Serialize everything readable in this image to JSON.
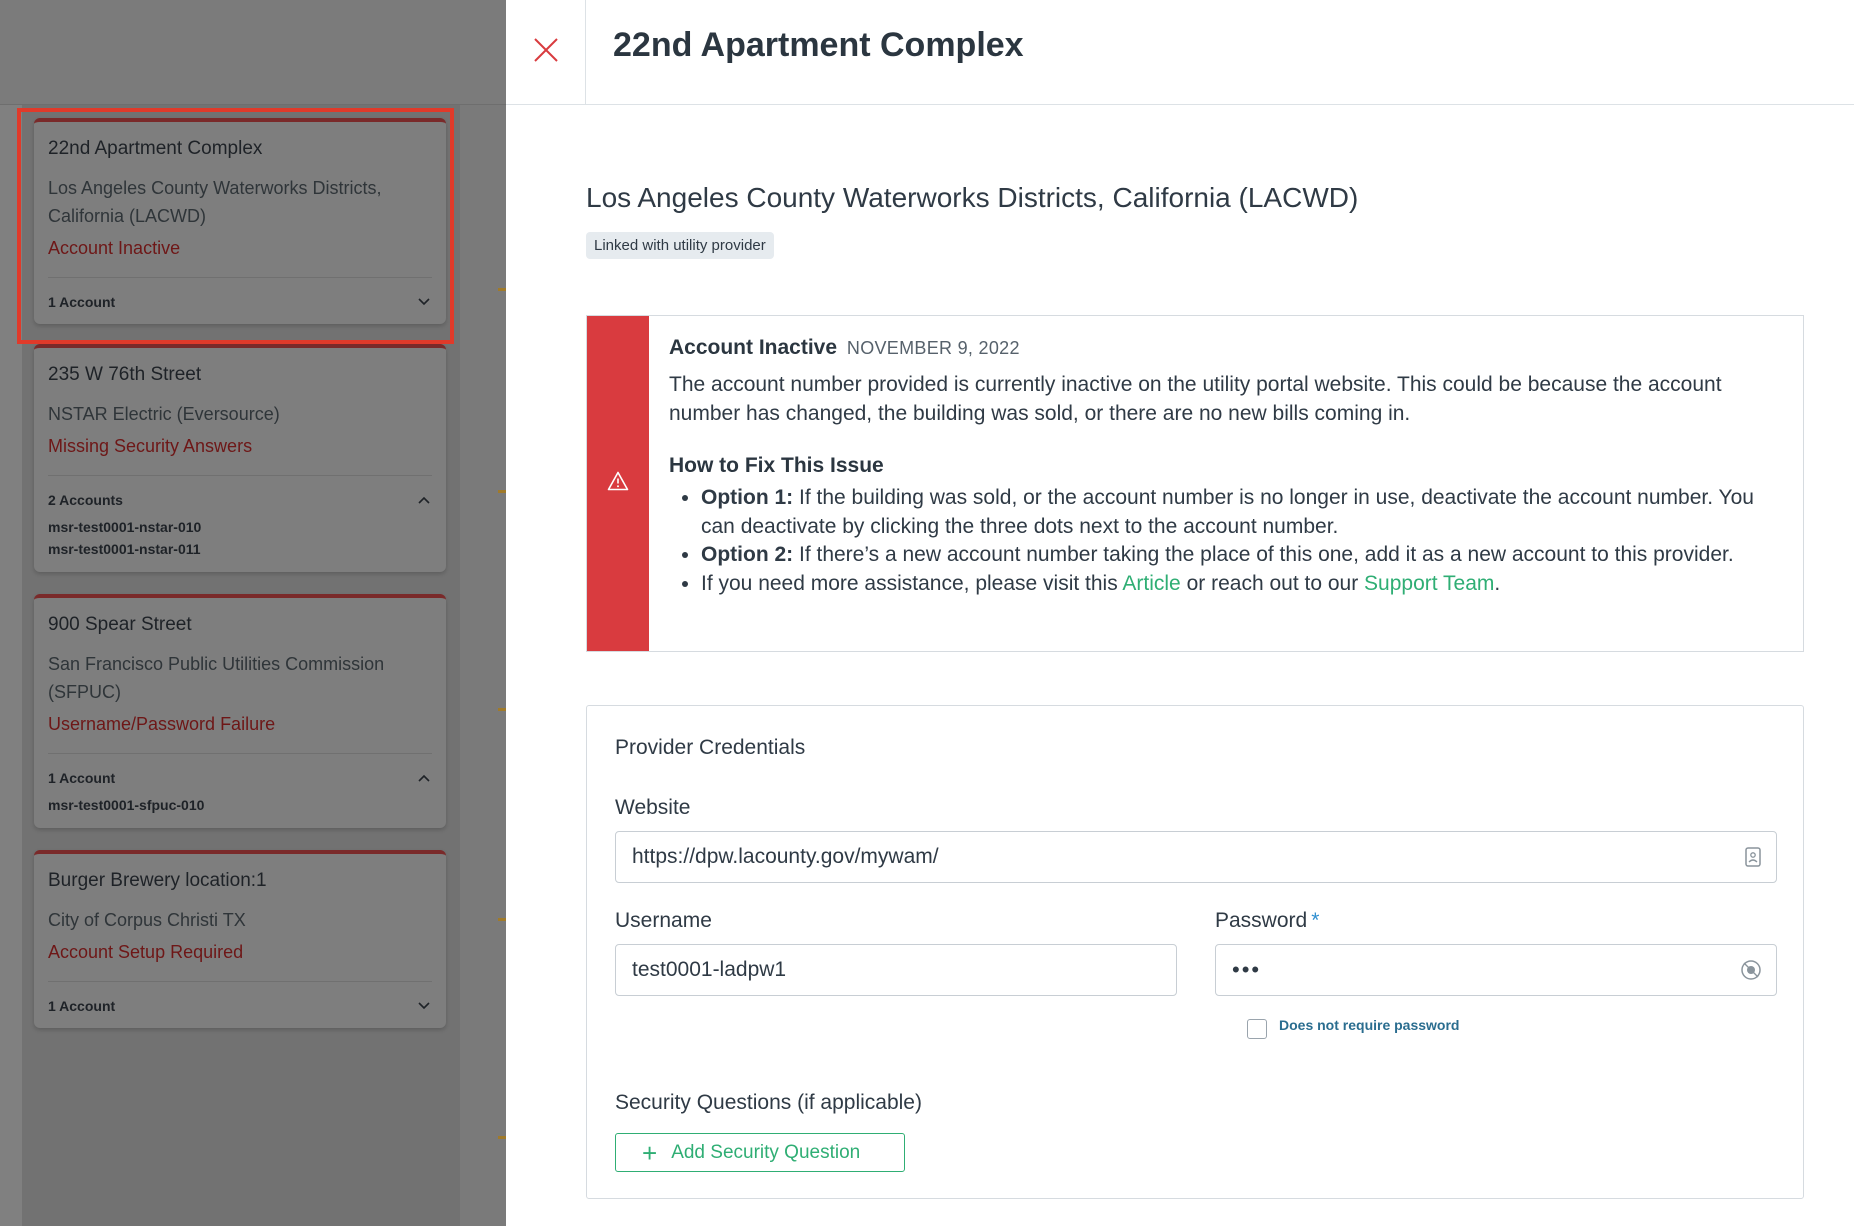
{
  "panel": {
    "title": "22nd Apartment Complex",
    "provider_name": "Los Angeles County Waterworks Districts, California (LACWD)",
    "linked_badge": "Linked with utility provider",
    "close_icon": "close-icon"
  },
  "alert": {
    "title": "Account Inactive",
    "date": "NOVEMBER 9, 2022",
    "description": "The account number provided is currently inactive on the utility portal website. This could be because the account number has changed, the building was sold, or there are no new bills coming in.",
    "fix_heading": "How to Fix This Issue",
    "option1_label": "Option 1:",
    "option1_text": " If the building was sold, or the account number is no longer in use, deactivate the account number. You can deactivate by clicking the three dots next to the account number.",
    "option2_label": "Option 2:",
    "option2_text": " If there’s a new account number taking the place of this one, add it as a new account to this provider.",
    "assist_prefix": "If you need more assistance, please visit this ",
    "article_link": "Article",
    "assist_middle": " or reach out to our ",
    "support_link": "Support Team",
    "assist_suffix": ".",
    "icon": "warning-icon",
    "color": "#d93b3f"
  },
  "credentials": {
    "title": "Provider Credentials",
    "website_label": "Website",
    "website_value": "https://dpw.lacounty.gov/mywam/",
    "username_label": "Username",
    "username_value": "test0001-ladpw1",
    "password_label": "Password",
    "password_required": "*",
    "password_value": "•••",
    "no_password_label": "Does not require password",
    "security_label": "Security Questions (if applicable)",
    "add_security_button": "Add Security Question"
  },
  "cards": [
    {
      "title": "22nd Apartment Complex",
      "provider": "Los Angeles County Waterworks Districts, California (LACWD)",
      "status": "Account Inactive",
      "accounts_label": "1 Account",
      "expanded": false,
      "accounts": []
    },
    {
      "title": "235 W 76th Street",
      "provider": "NSTAR Electric (Eversource)",
      "status": "Missing Security Answers",
      "accounts_label": "2 Accounts",
      "expanded": true,
      "accounts": [
        "msr-test0001-nstar-010",
        "msr-test0001-nstar-011"
      ]
    },
    {
      "title": "900 Spear Street",
      "provider": "San Francisco Public Utilities Commission (SFPUC)",
      "status": "Username/Password Failure",
      "accounts_label": "1 Account",
      "expanded": true,
      "accounts": [
        "msr-test0001-sfpuc-010"
      ]
    },
    {
      "title": "Burger Brewery location:1",
      "provider": "City of Corpus Christi TX",
      "status": "Account Setup Required",
      "accounts_label": "1 Account",
      "expanded": false,
      "accounts": []
    }
  ],
  "colors": {
    "accent_green": "#2fae74",
    "error_red": "#d93b3f",
    "highlight_red": "#e03a2a"
  }
}
